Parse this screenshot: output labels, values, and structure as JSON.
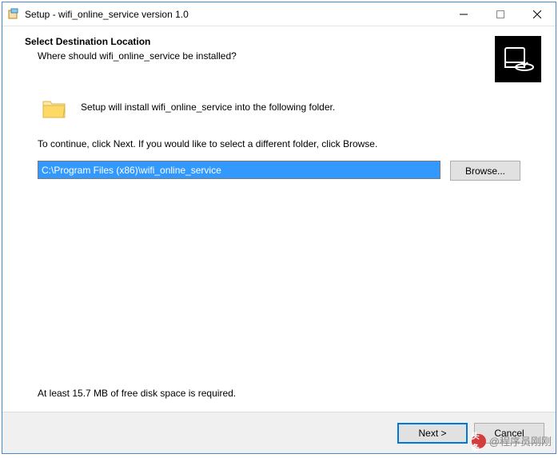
{
  "titlebar": {
    "title": "Setup - wifi_online_service version 1.0"
  },
  "header": {
    "title": "Select Destination Location",
    "subtitle": "Where should wifi_online_service be installed?"
  },
  "content": {
    "install_text": "Setup will install wifi_online_service into the following folder.",
    "continue_text": "To continue, click Next. If you would like to select a different folder, click Browse.",
    "path_value": "C:\\Program Files (x86)\\wifi_online_service",
    "browse_label": "Browse...",
    "disk_space": "At least 15.7 MB of free disk space is required."
  },
  "footer": {
    "next_label": "Next >",
    "cancel_label": "Cancel"
  },
  "watermark": {
    "label": "头条",
    "author": "@程序员刚刚"
  }
}
